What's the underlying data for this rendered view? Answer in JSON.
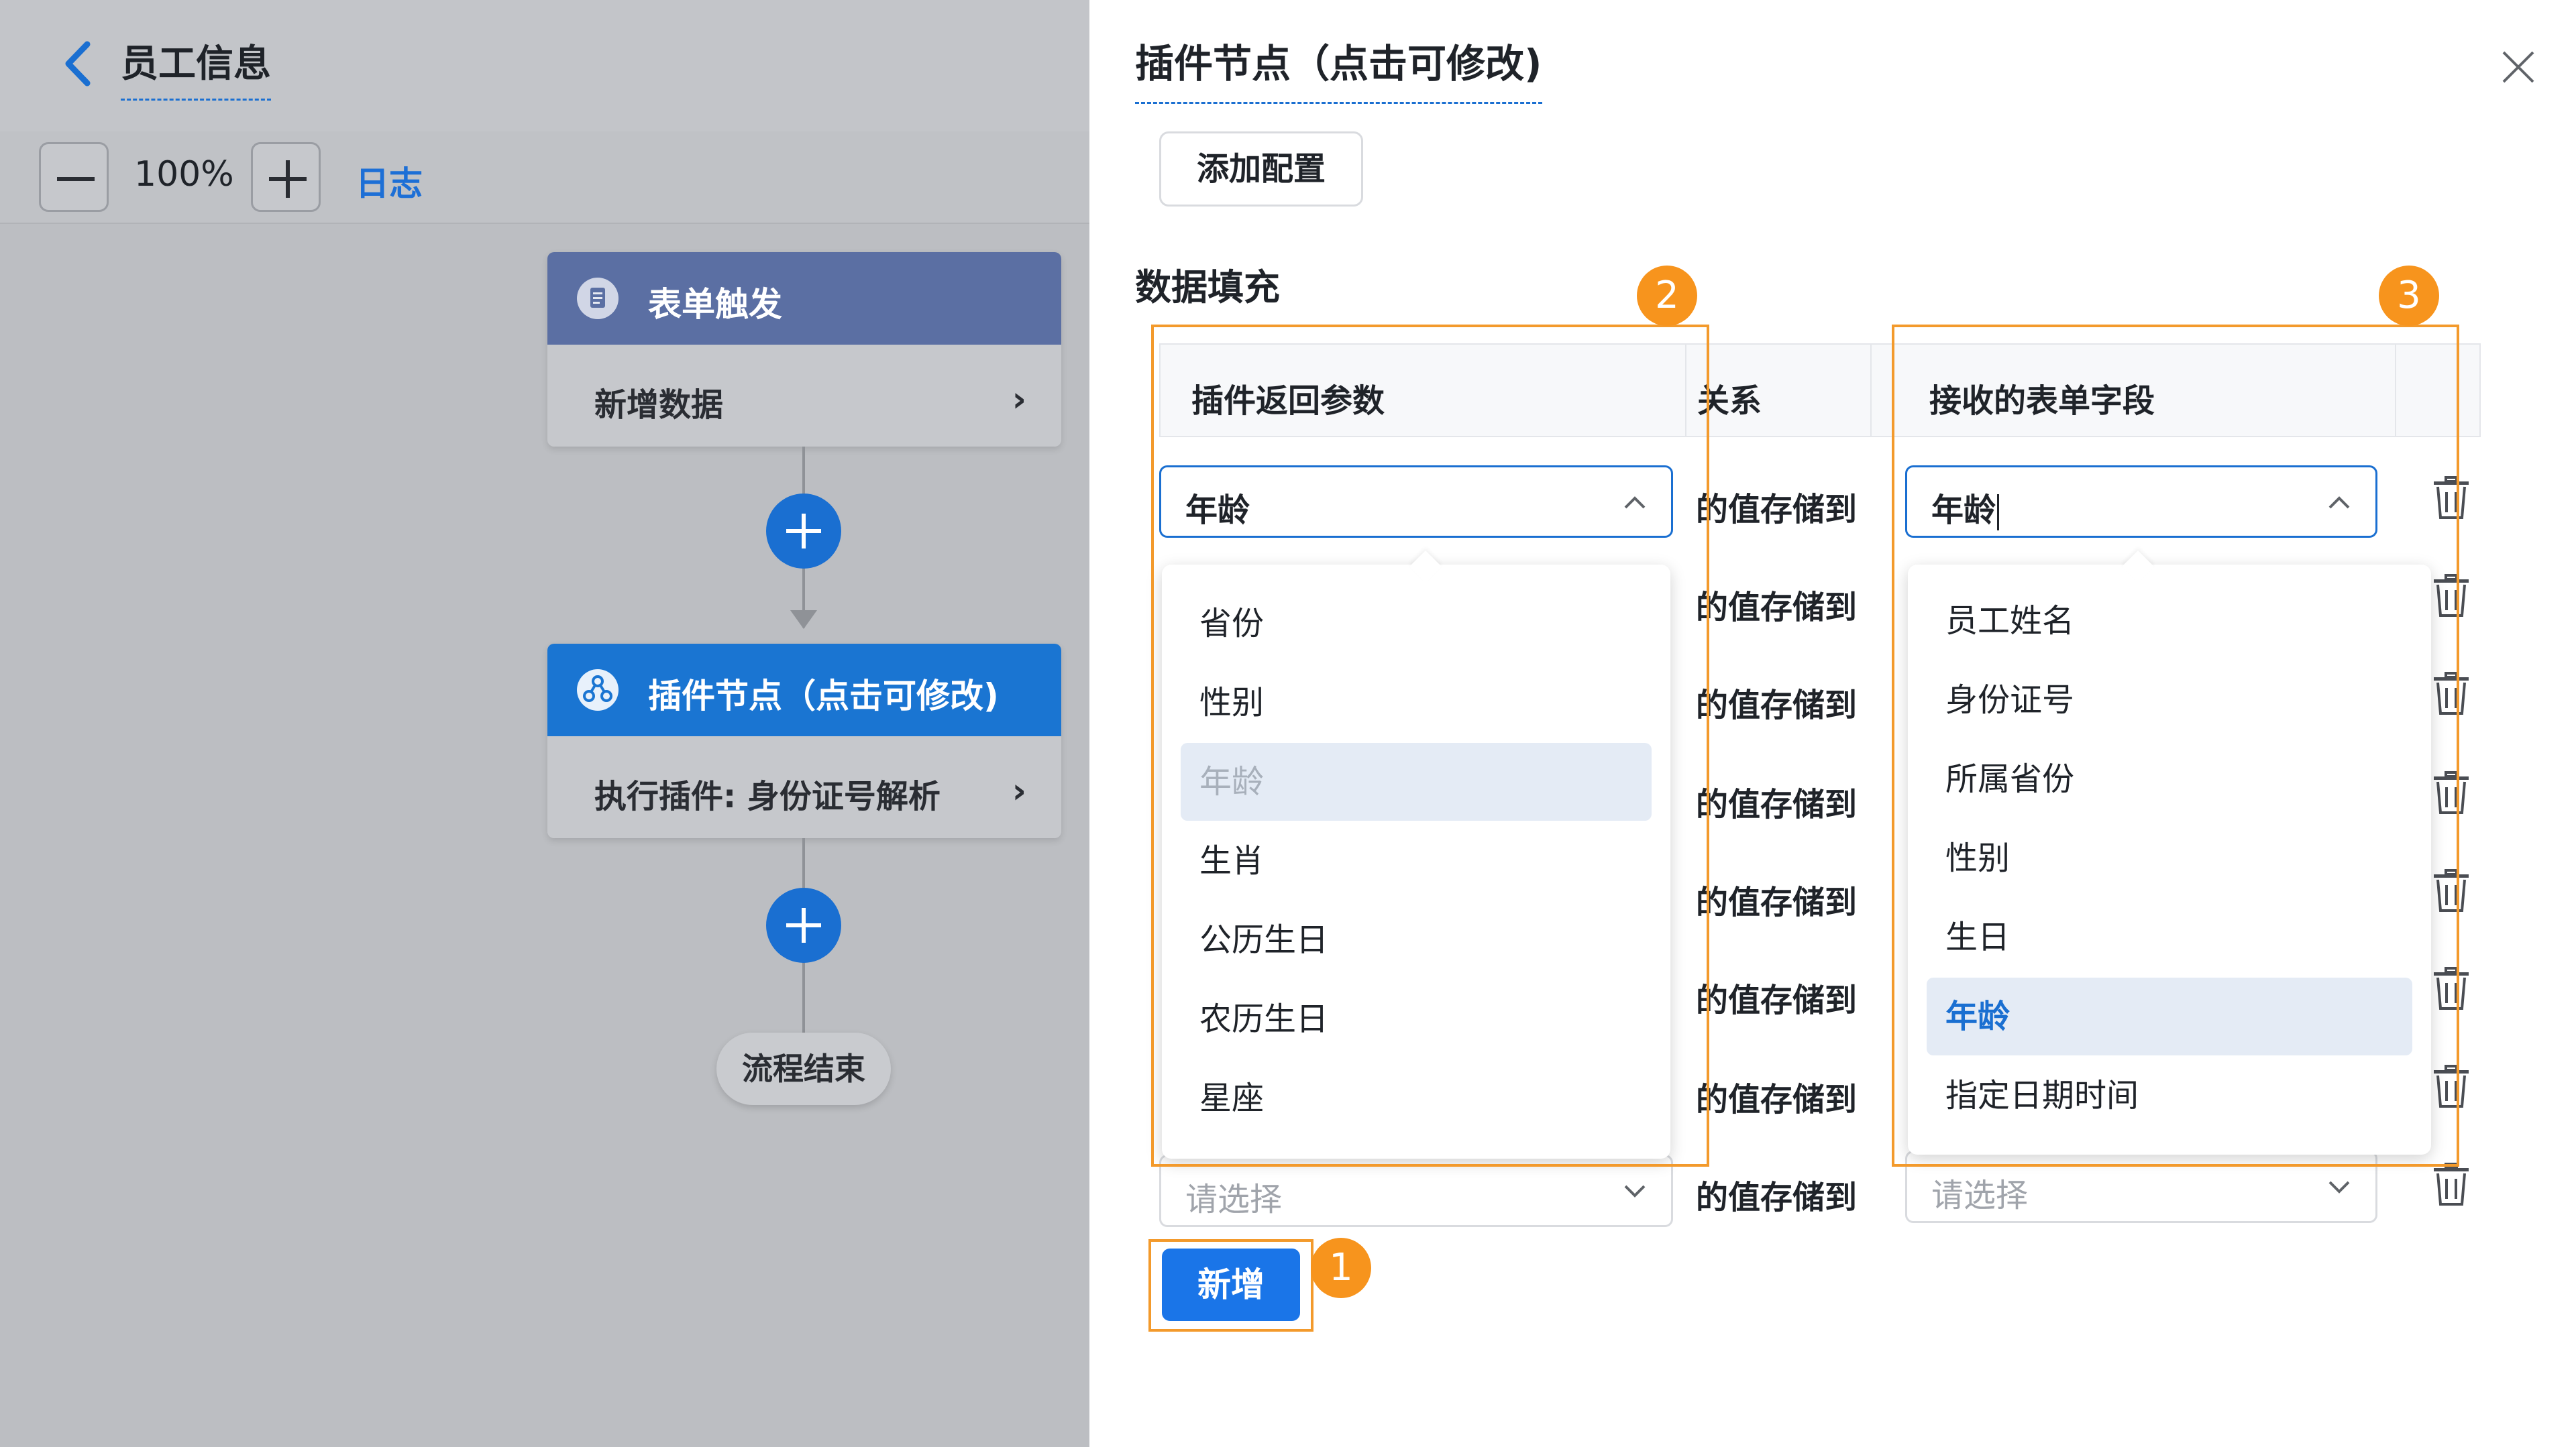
{
  "left": {
    "title": "员工信息",
    "zoom": "100%",
    "log_link": "日志",
    "trigger_node": {
      "title": "表单触发",
      "body": "新增数据",
      "chevron": "›"
    },
    "plugin_node": {
      "title": "插件节点（点击可修改)",
      "body": "执行插件: 身份证号解析",
      "chevron": "›"
    },
    "end_node": "流程结束"
  },
  "panel": {
    "title": "插件节点（点击可修改)",
    "add_config": "添加配置",
    "section_title": "数据填充",
    "table": {
      "headers": [
        "插件返回参数",
        "关系",
        "接收的表单字段"
      ]
    },
    "rows": [
      {
        "source": "年龄",
        "relation": "的值存储到",
        "target": "年龄"
      },
      {
        "relation": "的值存储到"
      },
      {
        "relation": "的值存储到"
      },
      {
        "relation": "的值存储到"
      },
      {
        "relation": "的值存储到"
      },
      {
        "relation": "的值存储到"
      },
      {
        "relation": "的值存储到"
      },
      {
        "source_placeholder": "请选择",
        "relation": "的值存储到",
        "target_placeholder": "请选择"
      }
    ],
    "source_options": [
      "省份",
      "性别",
      "年龄",
      "生肖",
      "公历生日",
      "农历生日",
      "星座"
    ],
    "target_options": [
      "员工姓名",
      "身份证号",
      "所属省份",
      "性别",
      "生日",
      "年龄",
      "指定日期时间"
    ],
    "add_button": "新增",
    "badges": [
      "1",
      "2",
      "3"
    ]
  },
  "colors": {
    "accent": "#1a6fd1",
    "highlight": "#f39a2c",
    "badge": "#f7941d"
  }
}
